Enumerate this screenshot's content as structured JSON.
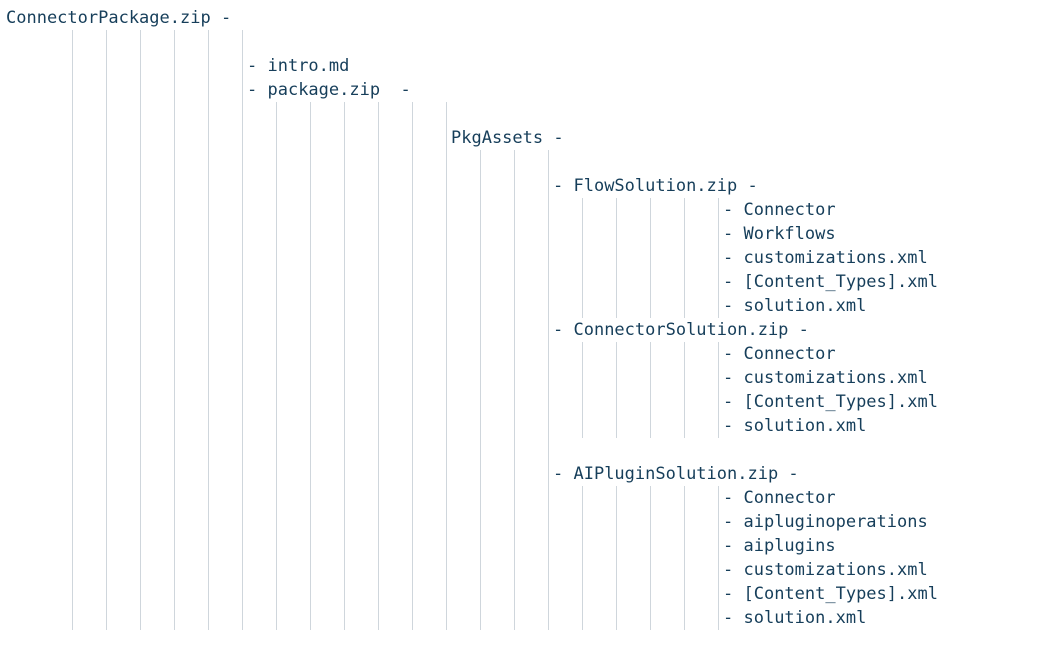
{
  "root": "ConnectorPackage.zip",
  "level1": {
    "intro": "intro.md",
    "package": "package.zip"
  },
  "level2": {
    "pkgassets": "PkgAssets"
  },
  "sol": {
    "flow": {
      "name": "FlowSolution.zip",
      "items": [
        "Connector",
        "Workflows",
        "customizations.xml",
        "[Content_Types].xml",
        "solution.xml"
      ]
    },
    "connector": {
      "name": "ConnectorSolution.zip",
      "items": [
        "Connector",
        "customizations.xml",
        "[Content_Types].xml",
        "solution.xml"
      ]
    },
    "ai": {
      "name": "AIPluginSolution.zip",
      "items": [
        "Connector",
        "aipluginoperations",
        "aiplugins",
        "customizations.xml",
        "[Content_Types].xml",
        "solution.xml"
      ]
    }
  }
}
